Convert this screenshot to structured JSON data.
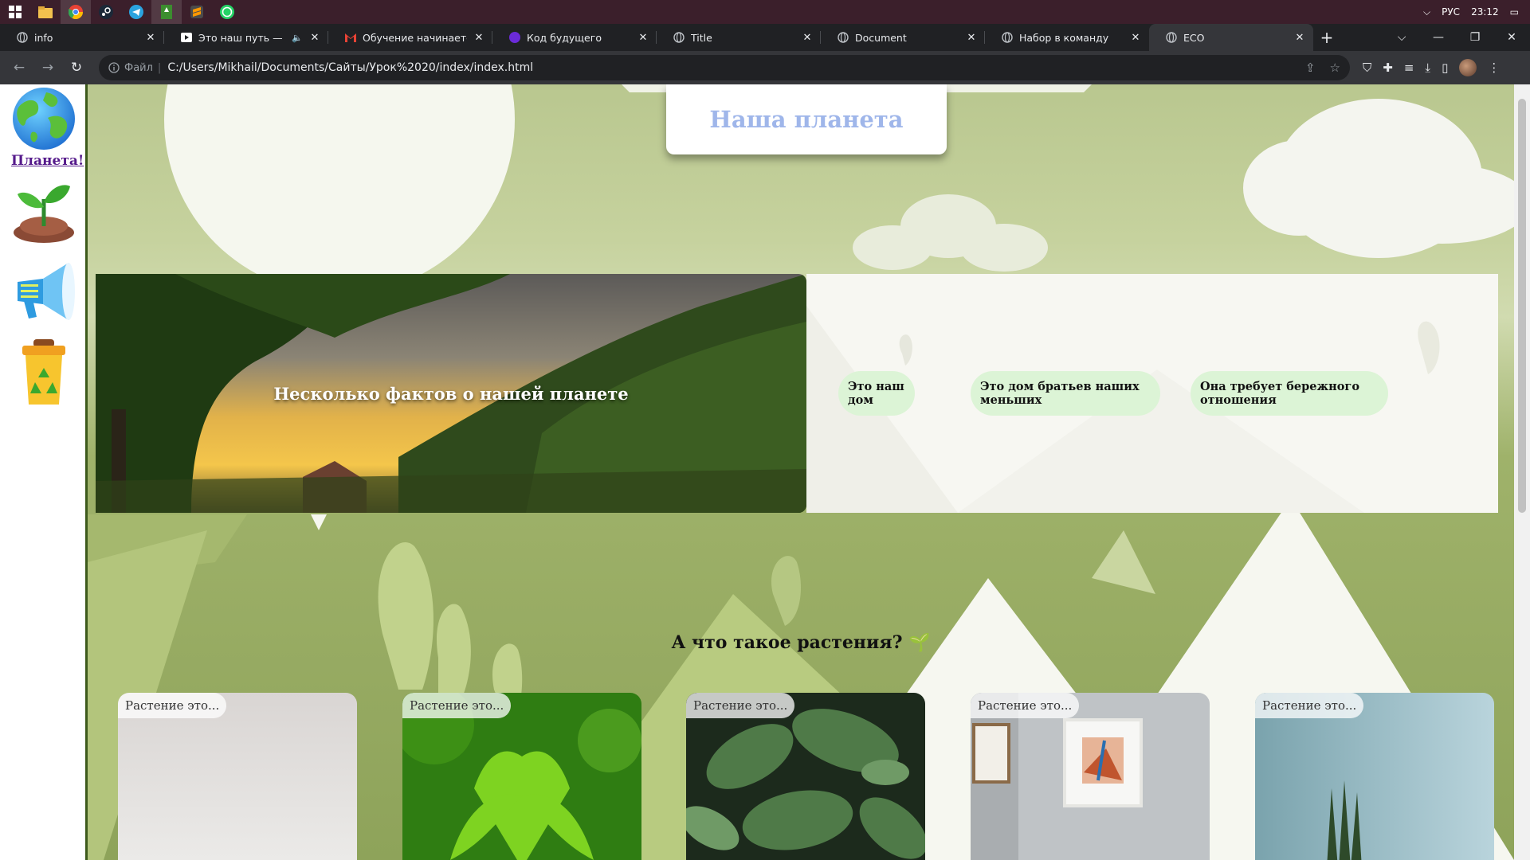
{
  "taskbar": {
    "apps": [
      "start-icon",
      "file-explorer-icon",
      "chrome-icon",
      "steam-icon",
      "telegram-icon",
      "app-icon",
      "sublime-icon",
      "whatsapp-icon"
    ],
    "lang": "РУС",
    "time": "23:12"
  },
  "tabs": [
    {
      "label": "info",
      "icon": "globe-icon"
    },
    {
      "label": "Это наш путь — Ма...",
      "icon": "youtube-icon"
    },
    {
      "label": "Обучение начинается с",
      "icon": "gmail-icon"
    },
    {
      "label": "Код будущего",
      "icon": "code-future-icon"
    },
    {
      "label": "Title",
      "icon": "globe-icon"
    },
    {
      "label": "Document",
      "icon": "globe-icon"
    },
    {
      "label": "Набор в команду",
      "icon": "globe-icon"
    },
    {
      "label": "ECO",
      "icon": "globe-icon"
    }
  ],
  "address": {
    "scheme_label": "Файл",
    "url": "C:/Users/Mikhail/Documents/Сайты/Урок%2020/index/index.html"
  },
  "sidebar": {
    "link_label": "Планета!"
  },
  "page": {
    "title": "Наша планета",
    "photo_caption": "Несколько фактов о нашей планете",
    "facts": [
      "Это наш дом",
      "Это дом братьев наших меньших",
      "Она требует бережного отношения"
    ],
    "section_title": "А что такое растения? 🌱",
    "plant_cards": [
      {
        "label": "Растение это..."
      },
      {
        "label": "Растение это..."
      },
      {
        "label": "Растение это..."
      },
      {
        "label": "Растение это..."
      },
      {
        "label": "Растение это..."
      }
    ]
  },
  "colors": {
    "title_text": "#9fb6ea",
    "fact_pill": "#dcf4d6",
    "link": "#551a8b"
  }
}
